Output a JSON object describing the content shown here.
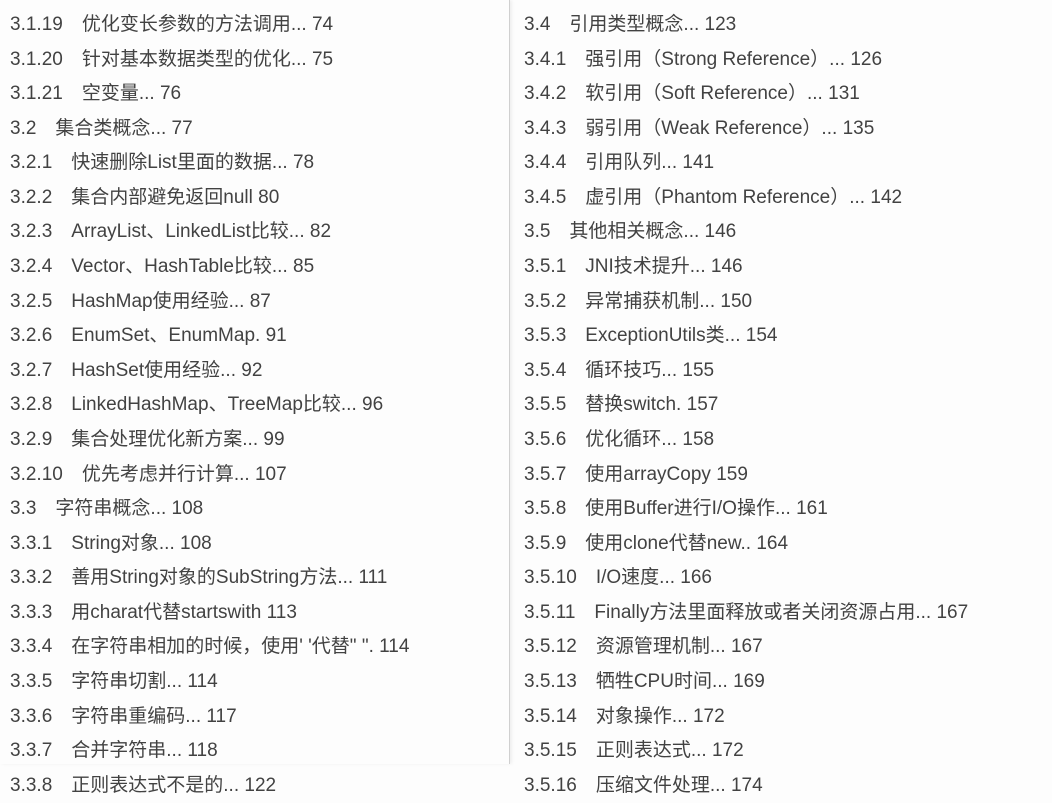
{
  "left": [
    {
      "num": "3.1.19",
      "title": "优化变长参数的方法调用...",
      "page": "74"
    },
    {
      "num": "3.1.20",
      "title": "针对基本数据类型的优化...",
      "page": "75"
    },
    {
      "num": "3.1.21",
      "title": "空变量...",
      "page": "76"
    },
    {
      "num": "3.2",
      "title": "集合类概念...",
      "page": "77"
    },
    {
      "num": "3.2.1",
      "title": "快速删除List里面的数据...",
      "page": "78"
    },
    {
      "num": "3.2.2",
      "title": "集合内部避免返回null",
      "page": "80"
    },
    {
      "num": "3.2.3",
      "title": "ArrayList、LinkedList比较...",
      "page": "82"
    },
    {
      "num": "3.2.4",
      "title": "Vector、HashTable比较...",
      "page": "85"
    },
    {
      "num": "3.2.5",
      "title": "HashMap使用经验...",
      "page": "87"
    },
    {
      "num": "3.2.6",
      "title": "EnumSet、EnumMap.",
      "page": "91"
    },
    {
      "num": "3.2.7",
      "title": "HashSet使用经验...",
      "page": "92"
    },
    {
      "num": "3.2.8",
      "title": "LinkedHashMap、TreeMap比较...",
      "page": "96"
    },
    {
      "num": "3.2.9",
      "title": "集合处理优化新方案...",
      "page": "99"
    },
    {
      "num": "3.2.10",
      "title": "优先考虑并行计算...",
      "page": "107"
    },
    {
      "num": "3.3",
      "title": "字符串概念...",
      "page": "108"
    },
    {
      "num": "3.3.1",
      "title": "String对象...",
      "page": "108"
    },
    {
      "num": "3.3.2",
      "title": "善用String对象的SubString方法...",
      "page": "111"
    },
    {
      "num": "3.3.3",
      "title": "用charat代替startswith",
      "page": "113"
    },
    {
      "num": "3.3.4",
      "title": "在字符串相加的时候，使用' '代替\" \".",
      "page": "114"
    },
    {
      "num": "3.3.5",
      "title": "字符串切割...",
      "page": "114"
    },
    {
      "num": "3.3.6",
      "title": "字符串重编码...",
      "page": "117"
    },
    {
      "num": "3.3.7",
      "title": "合并字符串...",
      "page": "118"
    },
    {
      "num": "3.3.8",
      "title": "正则表达式不是的...",
      "page": "122"
    }
  ],
  "right": [
    {
      "num": "3.4",
      "title": "引用类型概念...",
      "page": "123"
    },
    {
      "num": "3.4.1",
      "title": "强引用（Strong Reference）...",
      "page": "126"
    },
    {
      "num": "3.4.2",
      "title": "软引用（Soft Reference）...",
      "page": "131"
    },
    {
      "num": "3.4.3",
      "title": "弱引用（Weak Reference）...",
      "page": "135"
    },
    {
      "num": "3.4.4",
      "title": "引用队列...",
      "page": "141"
    },
    {
      "num": "3.4.5",
      "title": "虚引用（Phantom Reference）...",
      "page": "142"
    },
    {
      "num": "3.5",
      "title": "其他相关概念...",
      "page": "146"
    },
    {
      "num": "3.5.1",
      "title": "JNI技术提升...",
      "page": "146"
    },
    {
      "num": "3.5.2",
      "title": "异常捕获机制...",
      "page": "150"
    },
    {
      "num": "3.5.3",
      "title": "ExceptionUtils类...",
      "page": "154"
    },
    {
      "num": "3.5.4",
      "title": "循环技巧...",
      "page": "155"
    },
    {
      "num": "3.5.5",
      "title": "替换switch.",
      "page": "157"
    },
    {
      "num": "3.5.6",
      "title": "优化循环...",
      "page": "158"
    },
    {
      "num": "3.5.7",
      "title": "使用arrayCopy",
      "page": "159"
    },
    {
      "num": "3.5.8",
      "title": "使用Buffer进行I/O操作...",
      "page": "161"
    },
    {
      "num": "3.5.9",
      "title": "使用clone代替new..",
      "page": "164"
    },
    {
      "num": "3.5.10",
      "title": "I/O速度...",
      "page": "166"
    },
    {
      "num": "3.5.11",
      "title": "Finally方法里面释放或者关闭资源占用...",
      "page": "167"
    },
    {
      "num": "3.5.12",
      "title": "资源管理机制...",
      "page": "167"
    },
    {
      "num": "3.5.13",
      "title": "牺牲CPU时间...",
      "page": "169"
    },
    {
      "num": "3.5.14",
      "title": "对象操作...",
      "page": "172"
    },
    {
      "num": "3.5.15",
      "title": "正则表达式...",
      "page": "172"
    },
    {
      "num": "3.5.16",
      "title": "压缩文件处理...",
      "page": "174"
    }
  ]
}
